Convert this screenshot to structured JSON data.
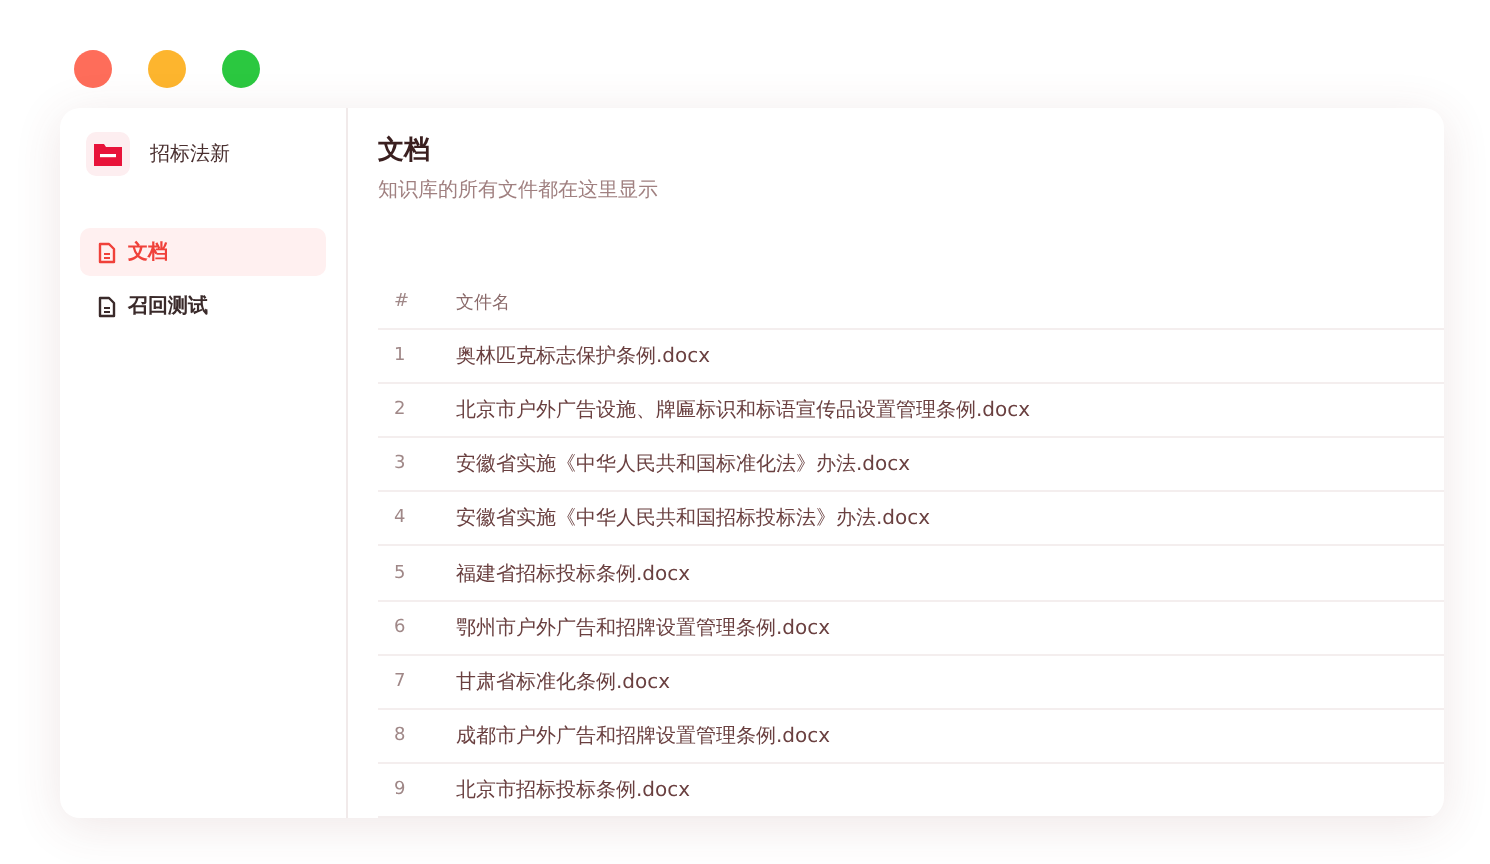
{
  "window": {
    "controls": [
      {
        "color": "#fe6d5a"
      },
      {
        "color": "#fdb52e"
      },
      {
        "color": "#2bc840"
      }
    ]
  },
  "sidebar": {
    "app_name": "招标法新",
    "items": [
      {
        "label": "文档",
        "selected": true
      },
      {
        "label": "召回测试",
        "selected": false
      }
    ]
  },
  "page": {
    "title": "文档",
    "subtitle": "知识库的所有文件都在这里显示"
  },
  "table": {
    "columns": [
      "#",
      "文件名"
    ],
    "rows": [
      {
        "number": "1",
        "name": "奥林匹克标志保护条例.docx"
      },
      {
        "number": "2",
        "name": "北京市户外广告设施、牌匾标识和标语宣传品设置管理条例.docx"
      },
      {
        "number": "3",
        "name": "安徽省实施《中华人民共和国标准化法》办法.docx"
      },
      {
        "number": "4",
        "name": "安徽省实施《中华人民共和国招标投标法》办法.docx"
      },
      {
        "number": "5",
        "name": "福建省招标投标条例.docx"
      },
      {
        "number": "6",
        "name": "鄂州市户外广告和招牌设置管理条例.docx"
      },
      {
        "number": "7",
        "name": "甘肃省标准化条例.docx"
      },
      {
        "number": "8",
        "name": "成都市户外广告和招牌设置管理条例.docx"
      },
      {
        "number": "9",
        "name": "北京市招标投标条例.docx"
      }
    ]
  }
}
